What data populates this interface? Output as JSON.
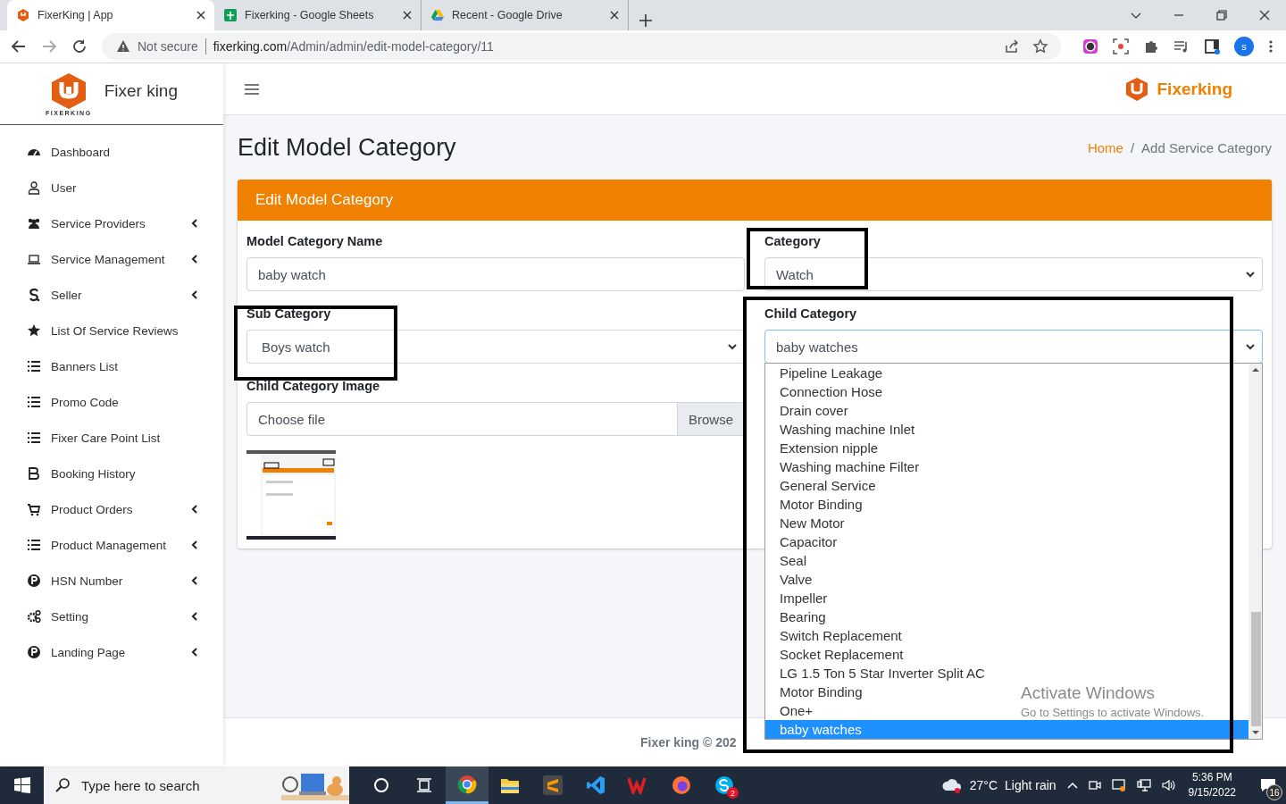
{
  "browser": {
    "tabs": [
      {
        "title": "FixerKing | App",
        "selected": true
      },
      {
        "title": "Fixerking - Google Sheets",
        "selected": false
      },
      {
        "title": "Recent - Google Drive",
        "selected": false
      }
    ],
    "security": "Not secure",
    "url_host": "fixerking.com",
    "url_path": "/Admin/admin/edit-model-category/11",
    "profile_initial": "s"
  },
  "sidebar": {
    "brand": "Fixer king",
    "logo_caption": "FIXERKING",
    "items": [
      {
        "label": "Dashboard",
        "has_submenu": false
      },
      {
        "label": "User",
        "has_submenu": false
      },
      {
        "label": "Service Providers",
        "has_submenu": true
      },
      {
        "label": "Service Management",
        "has_submenu": true
      },
      {
        "label": "Seller",
        "has_submenu": true
      },
      {
        "label": "List Of Service Reviews",
        "has_submenu": false
      },
      {
        "label": "Banners List",
        "has_submenu": false
      },
      {
        "label": "Promo Code",
        "has_submenu": false
      },
      {
        "label": "Fixer Care Point List",
        "has_submenu": false
      },
      {
        "label": "Booking History",
        "has_submenu": false
      },
      {
        "label": "Product Orders",
        "has_submenu": true
      },
      {
        "label": "Product Management",
        "has_submenu": true
      },
      {
        "label": "HSN Number",
        "has_submenu": true
      },
      {
        "label": "Setting",
        "has_submenu": true
      },
      {
        "label": "Landing Page",
        "has_submenu": true
      }
    ]
  },
  "topbar": {
    "brand": "Fixerking"
  },
  "page": {
    "title": "Edit Model Category",
    "breadcrumb_separator": "/",
    "breadcrumb": [
      {
        "label": "Home",
        "link": true
      },
      {
        "label": "Add Service Category",
        "link": false
      }
    ]
  },
  "card": {
    "title": "Edit Model Category",
    "model_category_name": {
      "label": "Model Category Name",
      "value": "baby watch"
    },
    "category": {
      "label": "Category",
      "value": "Watch"
    },
    "sub_category": {
      "label": "Sub Category",
      "value": "Boys watch"
    },
    "child_category": {
      "label": "Child Category",
      "value": "baby watches",
      "expanded": true,
      "options": [
        {
          "label": "Pipeline Leakage",
          "selected": false
        },
        {
          "label": "Connection Hose",
          "selected": false
        },
        {
          "label": "Drain cover",
          "selected": false
        },
        {
          "label": "Washing machine Inlet",
          "selected": false
        },
        {
          "label": "Extension nipple",
          "selected": false
        },
        {
          "label": "Washing machine Filter",
          "selected": false
        },
        {
          "label": "General Service",
          "selected": false
        },
        {
          "label": "Motor Binding",
          "selected": false
        },
        {
          "label": "New Motor",
          "selected": false
        },
        {
          "label": "Capacitor",
          "selected": false
        },
        {
          "label": "Seal",
          "selected": false
        },
        {
          "label": "Valve",
          "selected": false
        },
        {
          "label": "Impeller",
          "selected": false
        },
        {
          "label": "Bearing",
          "selected": false
        },
        {
          "label": "Switch Replacement",
          "selected": false
        },
        {
          "label": "Socket Replacement",
          "selected": false
        },
        {
          "label": "LG 1.5 Ton 5 Star Inverter Split AC",
          "selected": false
        },
        {
          "label": "Motor Binding",
          "selected": false
        },
        {
          "label": "One+",
          "selected": false
        },
        {
          "label": "baby watches",
          "selected": true
        }
      ]
    },
    "image": {
      "label": "Child Category Image",
      "placeholder": "Choose file",
      "button": "Browse"
    }
  },
  "footer": "Fixer king © 202",
  "activation": {
    "title": "Activate Windows",
    "subtitle": "Go to Settings to activate Windows."
  },
  "taskbar": {
    "search_placeholder": "Type here to search",
    "weather": "27°C",
    "weather_text": "Light rain",
    "time": "5:36 PM",
    "date": "9/15/2022",
    "notifications": "16",
    "skype_badge": "2"
  }
}
